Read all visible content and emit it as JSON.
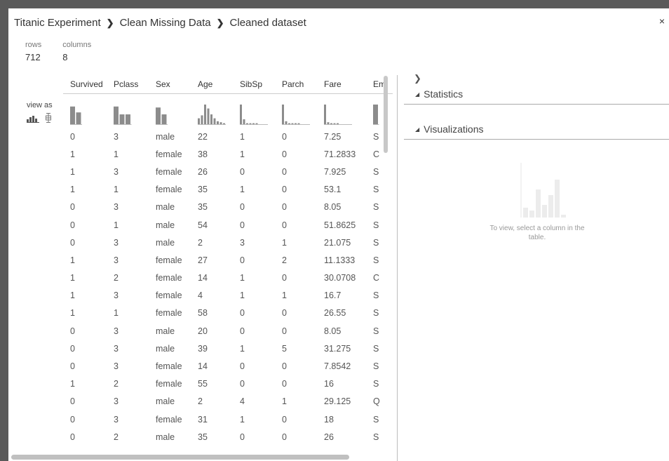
{
  "breadcrumb": [
    "Titanic Experiment",
    "Clean Missing Data",
    "Cleaned dataset"
  ],
  "close_glyph": "×",
  "stats": {
    "rows_label": "rows",
    "rows_value": "712",
    "columns_label": "columns",
    "columns_value": "8"
  },
  "view_as": "view as",
  "columns": [
    "Survived",
    "Pclass",
    "Sex",
    "Age",
    "SibSp",
    "Parch",
    "Fare",
    "Em"
  ],
  "rows": [
    [
      "0",
      "3",
      "male",
      "22",
      "1",
      "0",
      "7.25",
      "S"
    ],
    [
      "1",
      "1",
      "female",
      "38",
      "1",
      "0",
      "71.2833",
      "C"
    ],
    [
      "1",
      "3",
      "female",
      "26",
      "0",
      "0",
      "7.925",
      "S"
    ],
    [
      "1",
      "1",
      "female",
      "35",
      "1",
      "0",
      "53.1",
      "S"
    ],
    [
      "0",
      "3",
      "male",
      "35",
      "0",
      "0",
      "8.05",
      "S"
    ],
    [
      "0",
      "1",
      "male",
      "54",
      "0",
      "0",
      "51.8625",
      "S"
    ],
    [
      "0",
      "3",
      "male",
      "2",
      "3",
      "1",
      "21.075",
      "S"
    ],
    [
      "1",
      "3",
      "female",
      "27",
      "0",
      "2",
      "11.1333",
      "S"
    ],
    [
      "1",
      "2",
      "female",
      "14",
      "1",
      "0",
      "30.0708",
      "C"
    ],
    [
      "1",
      "3",
      "female",
      "4",
      "1",
      "1",
      "16.7",
      "S"
    ],
    [
      "1",
      "1",
      "female",
      "58",
      "0",
      "0",
      "26.55",
      "S"
    ],
    [
      "0",
      "3",
      "male",
      "20",
      "0",
      "0",
      "8.05",
      "S"
    ],
    [
      "0",
      "3",
      "male",
      "39",
      "1",
      "5",
      "31.275",
      "S"
    ],
    [
      "0",
      "3",
      "female",
      "14",
      "0",
      "0",
      "7.8542",
      "S"
    ],
    [
      "1",
      "2",
      "female",
      "55",
      "0",
      "0",
      "16",
      "S"
    ],
    [
      "0",
      "3",
      "male",
      "2",
      "4",
      "1",
      "29.125",
      "Q"
    ],
    [
      "0",
      "3",
      "female",
      "31",
      "1",
      "0",
      "18",
      "S"
    ],
    [
      "0",
      "2",
      "male",
      "35",
      "0",
      "0",
      "26",
      "S"
    ]
  ],
  "histograms": [
    [
      0.9,
      0.6
    ],
    [
      0.9,
      0.5,
      0.5
    ],
    [
      0.85,
      0.5
    ],
    [
      0.3,
      0.45,
      1.0,
      0.8,
      0.5,
      0.3,
      0.15,
      0.1,
      0.05
    ],
    [
      1.0,
      0.25,
      0.05,
      0.05,
      0.05,
      0.05
    ],
    [
      1.0,
      0.15,
      0.05,
      0.05,
      0.05,
      0.05
    ],
    [
      1.0,
      0.1,
      0.05,
      0.05,
      0.05
    ],
    [
      1.0
    ]
  ],
  "panel": {
    "statistics": "Statistics",
    "visualizations": "Visualizations",
    "hint": "To view, select a column in the table."
  }
}
